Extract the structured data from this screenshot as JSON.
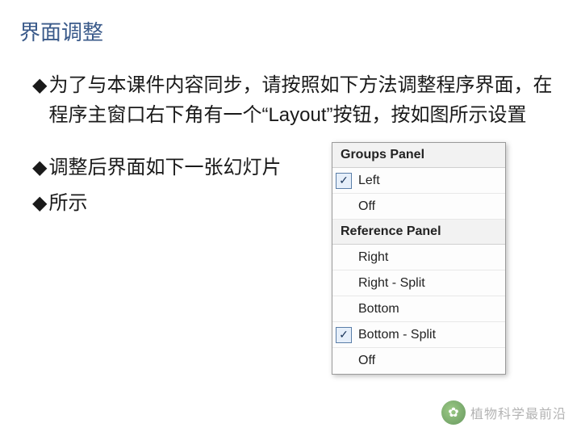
{
  "title": "界面调整",
  "bullets": [
    "为了与本课件内容同步，请按照如下方法调整程序界面，在程序主窗口右下角有一个“Layout”按钮，按如图所示设置",
    "调整后界面如下一张幻灯片",
    "所示"
  ],
  "menu": {
    "sections": [
      {
        "header": "Groups Panel",
        "items": [
          {
            "label": "Left",
            "checked": true
          },
          {
            "label": "Off",
            "checked": false
          }
        ]
      },
      {
        "header": "Reference Panel",
        "items": [
          {
            "label": "Right",
            "checked": false
          },
          {
            "label": "Right - Split",
            "checked": false
          },
          {
            "label": "Bottom",
            "checked": false
          },
          {
            "label": "Bottom - Split",
            "checked": true
          },
          {
            "label": "Off",
            "checked": false
          }
        ]
      }
    ]
  },
  "watermark": "植物科学最前沿",
  "marker": "◆",
  "check": "✓"
}
